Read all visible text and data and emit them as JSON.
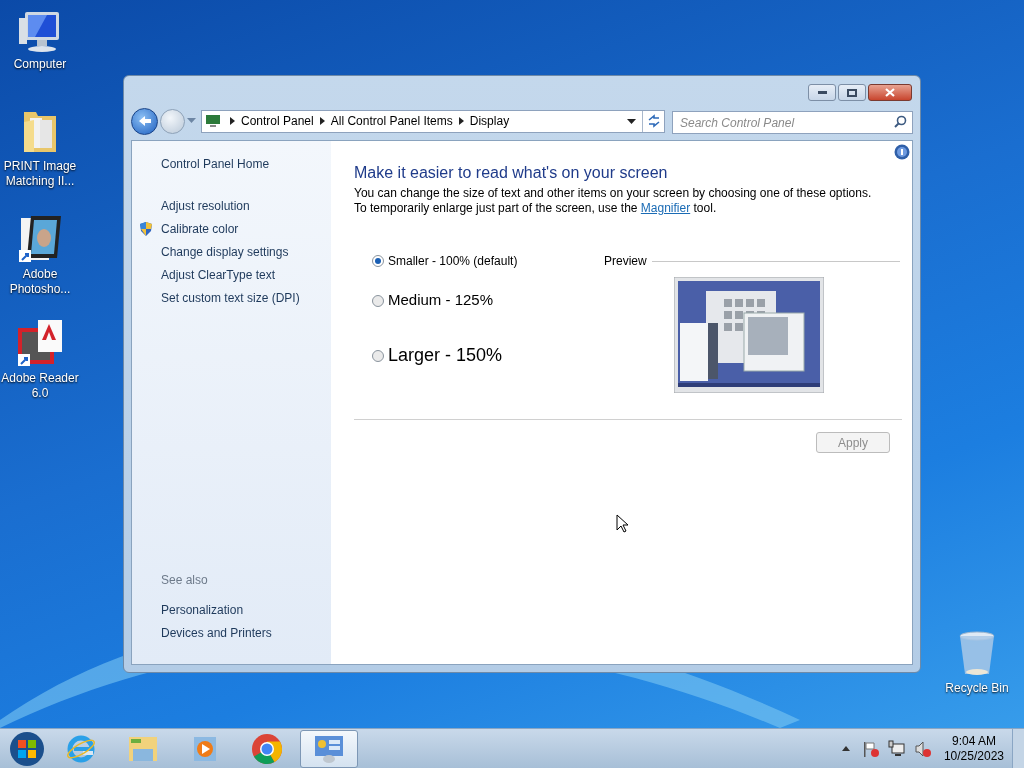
{
  "desktop_icons": [
    {
      "kind": "computer",
      "label": "Computer"
    },
    {
      "kind": "folder",
      "label": "PRINT Image Matching II..."
    },
    {
      "kind": "photo-app",
      "label": "Adobe Photosho..."
    },
    {
      "kind": "reader",
      "label": "Adobe Reader 6.0"
    },
    {
      "kind": "bin",
      "label": "Recycle Bin"
    }
  ],
  "window": {
    "breadcrumb": [
      "Control Panel",
      "All Control Panel Items",
      "Display"
    ],
    "search": {
      "placeholder": "Search Control Panel"
    },
    "sidebar": {
      "home": "Control Panel Home",
      "tasks": [
        {
          "label": "Adjust resolution",
          "shield": false
        },
        {
          "label": "Calibrate color",
          "shield": true
        },
        {
          "label": "Change display settings",
          "shield": false
        },
        {
          "label": "Adjust ClearType text",
          "shield": false
        },
        {
          "label": "Set custom text size (DPI)",
          "shield": false
        }
      ],
      "see_also_title": "See also",
      "see_also": [
        "Personalization",
        "Devices and Printers"
      ]
    },
    "main": {
      "heading": "Make it easier to read what's on your screen",
      "description_before": "You can change the size of text and other items on your screen by choosing one of these options. To temporarily enlarge just part of the screen, use the",
      "description_link": "Magnifier",
      "description_after": "tool.",
      "options": [
        {
          "kind": "small",
          "label": "Smaller - 100% (default)",
          "selected": true
        },
        {
          "kind": "medium",
          "label": "Medium - 125%",
          "selected": false
        },
        {
          "kind": "large",
          "label": "Larger - 150%",
          "selected": false
        }
      ],
      "preview_label": "Preview",
      "apply": {
        "label": "Apply",
        "disabled": true
      }
    }
  },
  "taskbar": {
    "items": [
      {
        "kind": "ie",
        "selected": false
      },
      {
        "kind": "explorer",
        "selected": false
      },
      {
        "kind": "media",
        "selected": false
      },
      {
        "kind": "chrome",
        "selected": false
      },
      {
        "kind": "control-panel",
        "selected": true
      }
    ],
    "time": "9:04 AM",
    "date": "10/25/2023"
  }
}
